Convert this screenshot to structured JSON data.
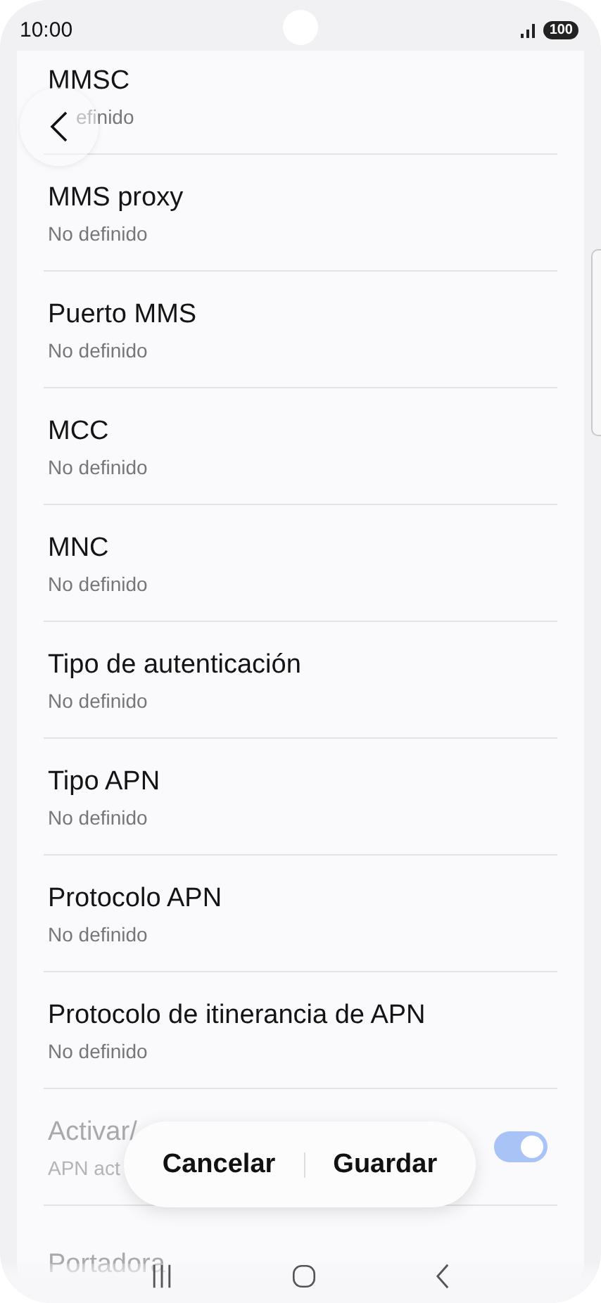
{
  "status_bar": {
    "time": "10:00",
    "battery": "100"
  },
  "rows": [
    {
      "kind": "text",
      "title": "MMSC",
      "value": "efinido",
      "disabled": false,
      "covered": true
    },
    {
      "kind": "text",
      "title": "MMS proxy",
      "value": "No definido",
      "disabled": false
    },
    {
      "kind": "text",
      "title": "Puerto MMS",
      "value": "No definido",
      "disabled": false
    },
    {
      "kind": "text",
      "title": "MCC",
      "value": "No definido",
      "disabled": false
    },
    {
      "kind": "text",
      "title": "MNC",
      "value": "No definido",
      "disabled": false
    },
    {
      "kind": "text",
      "title": "Tipo de autenticación",
      "value": "No definido",
      "disabled": false
    },
    {
      "kind": "text",
      "title": "Tipo APN",
      "value": "No definido",
      "disabled": false
    },
    {
      "kind": "text",
      "title": "Protocolo APN",
      "value": "No definido",
      "disabled": false
    },
    {
      "kind": "text",
      "title": "Protocolo de itinerancia de APN",
      "value": "No definido",
      "disabled": false
    },
    {
      "kind": "toggle",
      "title": "Activar/",
      "value": "APN act",
      "disabled": true,
      "on": true
    },
    {
      "kind": "text",
      "title": "Portadora",
      "disabled": true
    }
  ],
  "actions": [
    {
      "label": "Cancelar"
    },
    {
      "label": "Guardar"
    }
  ]
}
